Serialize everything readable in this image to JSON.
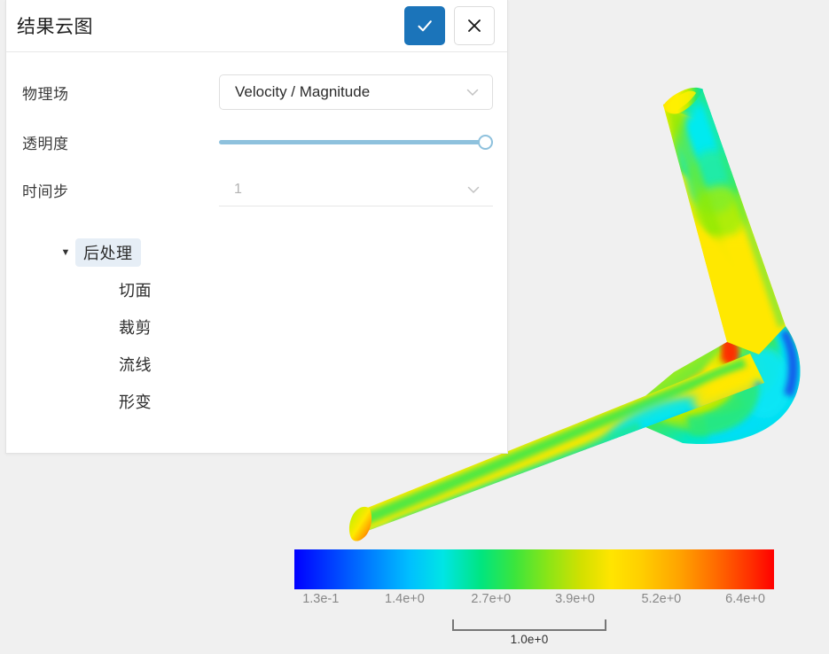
{
  "panel": {
    "title": "结果云图",
    "confirm_icon": "check-icon",
    "cancel_icon": "close-icon",
    "form": {
      "field_label": "物理场",
      "field_value": "Velocity / Magnitude",
      "field_chevron": "chevron-down-icon",
      "opacity_label": "透明度",
      "opacity_value": "100",
      "timestep_label": "时间步",
      "timestep_value": "1",
      "timestep_chevron": "chevron-down-icon"
    },
    "tree": {
      "root_label": "后处理",
      "root_arrow": "caret-down-icon",
      "children": [
        {
          "label": "切面"
        },
        {
          "label": "裁剪"
        },
        {
          "label": "流线"
        },
        {
          "label": "形变"
        }
      ]
    }
  },
  "legend": {
    "ticks": [
      "1.3e-1",
      "1.4e+0",
      "2.7e+0",
      "3.9e+0",
      "5.2e+0",
      "6.4e+0"
    ],
    "tick_positions_pct": [
      5.5,
      23.0,
      41.0,
      58.5,
      76.5,
      94.0
    ],
    "min_color": "#0000ff",
    "max_color": "#ff0000"
  },
  "scalebar": {
    "label": "1.0e+0"
  },
  "chart_data": {
    "type": "heatmap",
    "title": "Velocity / Magnitude",
    "colormap": "jet",
    "colorbar_ticks": [
      "1.3e-1",
      "1.4e+0",
      "2.7e+0",
      "3.9e+0",
      "5.2e+0",
      "6.4e+0"
    ],
    "colorbar_values": [
      0.13,
      1.4,
      2.7,
      3.9,
      5.2,
      6.4
    ],
    "vmin": 0.13,
    "vmax": 6.4,
    "units_scale": "1.0e+0",
    "geometry": "bent duct / elbow pipe surface contour",
    "xlabel": "",
    "ylabel": "",
    "legend_position": "bottom"
  },
  "viewport": {
    "background_color": "#f0f0f0"
  }
}
